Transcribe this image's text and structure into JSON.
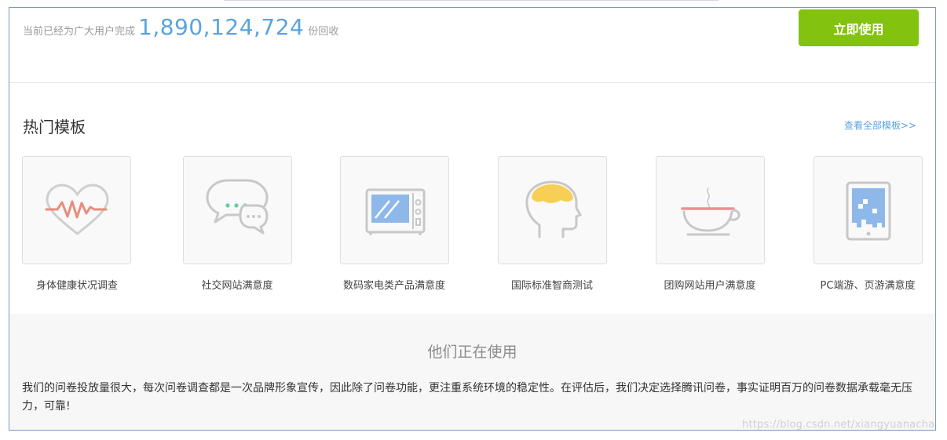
{
  "stats": {
    "prefix": "当前已经为广大用户完成",
    "count": "1,890,124,724",
    "suffix": "份回收",
    "cta_label": "立即使用"
  },
  "templates": {
    "title": "热门模板",
    "view_all": "查看全部模板>>",
    "items": [
      {
        "label": "身体健康状况调查",
        "icon": "heartbeat-icon"
      },
      {
        "label": "社交网站满意度",
        "icon": "chat-bubbles-icon"
      },
      {
        "label": "数码家电类产品满意度",
        "icon": "microwave-icon"
      },
      {
        "label": "国际标准智商测试",
        "icon": "brain-head-icon"
      },
      {
        "label": "团购网站用户满意度",
        "icon": "coffee-cup-icon"
      },
      {
        "label": "PC端游、页游满意度",
        "icon": "tablet-game-icon"
      }
    ]
  },
  "testimonial": {
    "title": "他们正在使用",
    "quote": "我们的问卷投放量很大，每次问卷调查都是一次品牌形象宣传，因此除了问卷功能，更注重系统环境的稳定性。在评估后，我们决定选择腾讯问卷，事实证明百万的问卷数据承载毫无压力，可靠!"
  },
  "watermark": "https://blog.csdn.net/xiangyuanacha",
  "colors": {
    "accent_blue": "#5aa3e0",
    "cta_green": "#83c20e",
    "frame_border": "#7d98c4"
  }
}
